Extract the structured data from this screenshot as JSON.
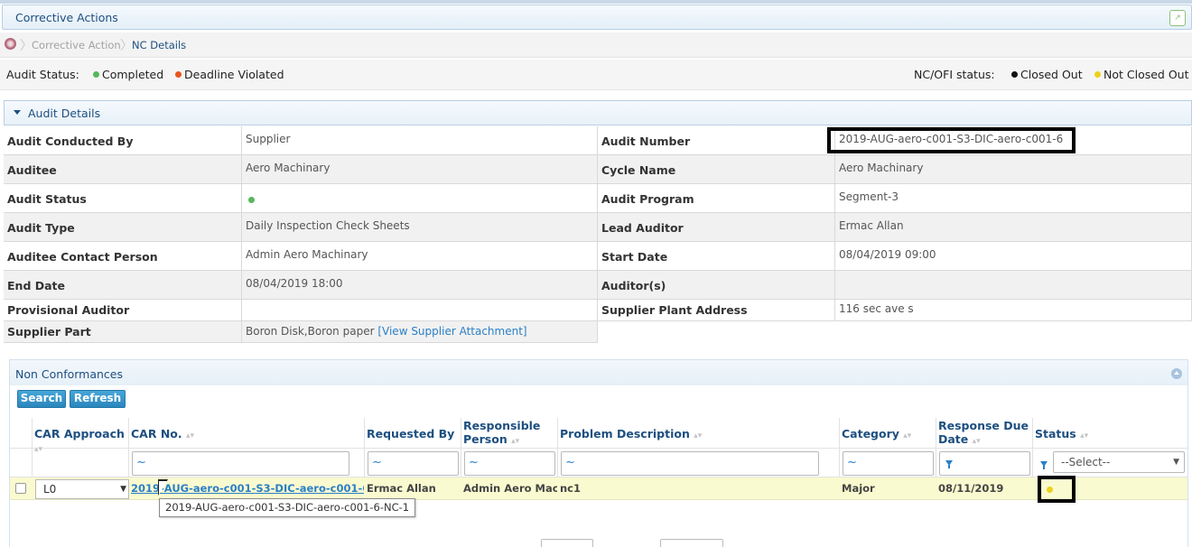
{
  "header": {
    "title": "Corrective Actions"
  },
  "breadcrumb": {
    "items": [
      "Corrective Action",
      "NC Details"
    ]
  },
  "status_bar": {
    "audit_status_label": "Audit Status:",
    "completed": "Completed",
    "deadline_violated": "Deadline Violated",
    "nc_status_label": "NC/OFI status:",
    "closed_out": "Closed Out",
    "not_closed_out": "Not Closed Out",
    "colors": {
      "completed": "#56b85a",
      "deadline_violated": "#e8541e",
      "closed_out": "#111111",
      "not_closed_out": "#ecd21a"
    }
  },
  "audit_details": {
    "section_title": "Audit Details",
    "rows": [
      {
        "l1": "Audit Conducted By",
        "v1": "Supplier",
        "l2": "Audit Number",
        "v2": "2019-AUG-aero-c001-S3-DIC-aero-c001-6"
      },
      {
        "l1": "Auditee",
        "v1": "Aero Machinary",
        "l2": "Cycle Name",
        "v2": "Aero Machinary"
      },
      {
        "l1": "Audit Status",
        "v1": "",
        "l2": "Audit Program",
        "v2": "Segment-3"
      },
      {
        "l1": "Audit Type",
        "v1": "Daily Inspection Check Sheets",
        "l2": "Lead Auditor",
        "v2": "Ermac Allan"
      },
      {
        "l1": "Auditee Contact Person",
        "v1": "Admin Aero Machinary",
        "l2": "Start Date",
        "v2": "08/04/2019 09:00"
      },
      {
        "l1": "End Date",
        "v1": "08/04/2019 18:00",
        "l2": "Auditor(s)",
        "v2": ""
      },
      {
        "l1": "Provisional Auditor",
        "v1": "",
        "l2": "Supplier Plant Address",
        "v2": "116 sec ave s"
      },
      {
        "l1": "Supplier Part",
        "v1": "Boron Disk,Boron paper",
        "link": "[View Supplier Attachment]"
      }
    ]
  },
  "nc": {
    "title": "Non Conformances",
    "search_label": "Search",
    "refresh_label": "Refresh",
    "columns": {
      "car_approach": "CAR Approach",
      "car_no": "CAR No.",
      "requested_by": "Requested By",
      "responsible_1": "Responsible",
      "responsible_2": "Person",
      "problem": "Problem Description",
      "category": "Category",
      "due_1": "Response Due",
      "due_2": "Date",
      "status": "Status"
    },
    "filter_symbol": "~",
    "status_select": "--Select--",
    "row": {
      "car_approach": "L0",
      "car_no": "2019-AUG-aero-c001-S3-DIC-aero-c001-6-NC-1",
      "requested_by": "Ermac Allan",
      "responsible": "Admin Aero Machinary",
      "problem": "nc1",
      "category": "Major",
      "due_date": "08/11/2019",
      "status": "Not Closed Out"
    },
    "tooltip": "2019-AUG-aero-c001-S3-DIC-aero-c001-6-NC-1"
  }
}
